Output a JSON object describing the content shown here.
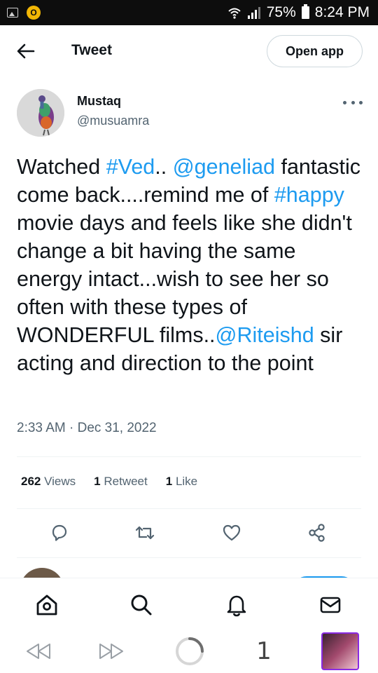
{
  "status_bar": {
    "badge": "O",
    "battery": "75%",
    "time": "8:24 PM"
  },
  "header": {
    "title": "Tweet",
    "open_app_label": "Open app"
  },
  "author": {
    "name": "Mustaq",
    "handle": "@musuamra"
  },
  "tweet": {
    "t1": "Watched ",
    "h1": "#Ved",
    "t2": ".. ",
    "m1": "@geneliad",
    "t3": " fantastic come back....remind me of ",
    "h2": "#happy",
    "t4": " movie days and feels like she didn't change a bit having the same energy intact...wish to see her so often with these types of WONDERFUL films..",
    "m2": "@Riteishd",
    "t5": " sir acting and direction to the point",
    "timestamp": "2:33 AM · Dec 31, 2022"
  },
  "stats": {
    "views_count": "262",
    "views_label": "Views",
    "retweets_count": "1",
    "retweets_label": "Retweet",
    "likes_count": "1",
    "likes_label": "Like"
  },
  "colors": {
    "link": "#1d9bf0",
    "secondary_text": "#536471",
    "primary_text": "#0f1419"
  },
  "icons": {
    "actions": [
      "reply-icon",
      "retweet-icon",
      "like-icon",
      "share-icon"
    ],
    "nav": [
      "home-icon",
      "search-icon",
      "notifications-icon",
      "messages-icon"
    ]
  },
  "system_bar": {
    "tab_count": "1"
  }
}
